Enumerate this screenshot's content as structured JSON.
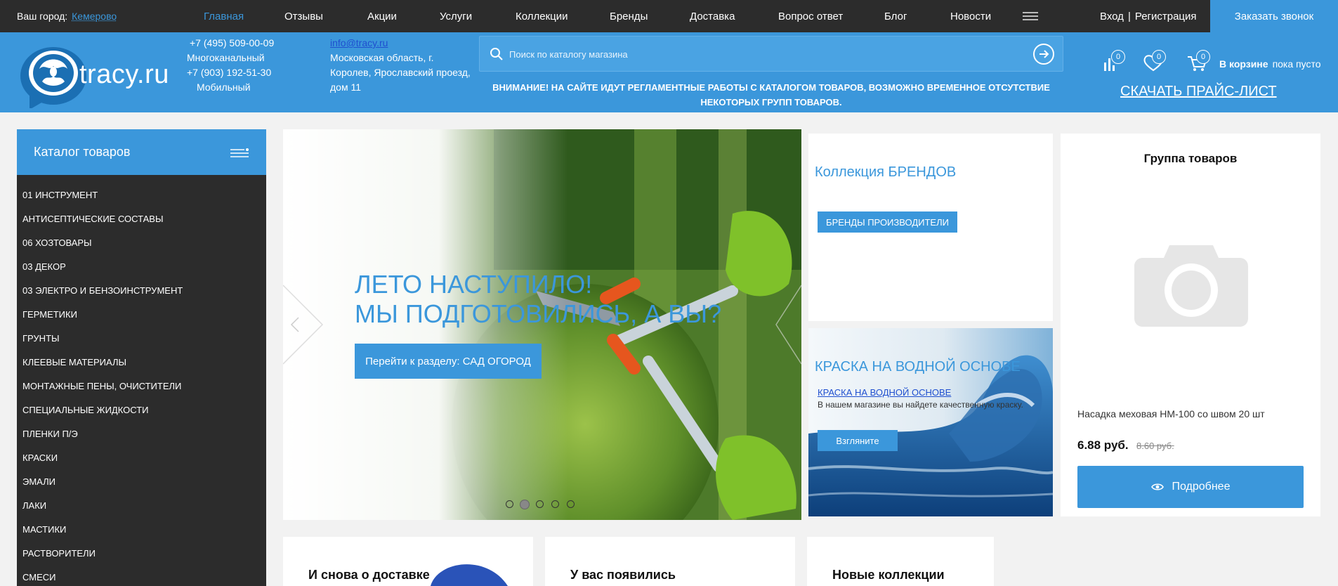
{
  "topbar": {
    "city_label": "Ваш город:",
    "city_name": "Кемерово",
    "nav": [
      "Главная",
      "Отзывы",
      "Акции",
      "Услуги",
      "Коллекции",
      "Бренды",
      "Доставка",
      "Вопрос ответ",
      "Блог",
      "Новости"
    ],
    "login": "Вход",
    "separator": "|",
    "register": "Регистрация",
    "callback": "Заказать звонок"
  },
  "header": {
    "logo_text": "tracy.ru",
    "phone1": "+7 (495) 509-00-09",
    "phone1_label": "Многоканальный",
    "phone2": "+7 (903) 192-51-30",
    "phone2_label": "Мобильный",
    "email": "info@tracy.ru",
    "address": "Московская область, г. Королев, Ярославский проезд, дом 11",
    "search_placeholder": "Поиск по каталогу магазина",
    "notice": "ВНИМАНИЕ! НА САЙТЕ ИДУТ РЕГЛАМЕНТНЫЕ РАБОТЫ С КАТАЛОГОМ ТОВАРОВ, ВОЗМОЖНО ВРЕМЕННОЕ ОТСУТСТВИЕ НЕКОТОРЫХ ГРУПП ТОВАРОВ.",
    "compare_count": "0",
    "favorites_count": "0",
    "cart_count": "0",
    "cart_label": "В корзине",
    "cart_status": "пока пусто",
    "pricelist": "СКАЧАТЬ ПРАЙС-ЛИСТ"
  },
  "catalog": {
    "title": "Каталог товаров",
    "items": [
      "01 ИНСТРУМЕНТ",
      "АНТИСЕПТИЧЕСКИЕ СОСТАВЫ",
      "06 ХОЗТОВАРЫ",
      "03 ДЕКОР",
      "03 ЭЛЕКТРО И БЕНЗОИНСТРУМЕНТ",
      "ГЕРМЕТИКИ",
      "ГРУНТЫ",
      "КЛЕЕВЫЕ МАТЕРИАЛЫ",
      "МОНТАЖНЫЕ ПЕНЫ, ОЧИСТИТЕЛИ",
      "СПЕЦИАЛЬНЫЕ ЖИДКОСТИ",
      "ПЛЕНКИ П/Э",
      "КРАСКИ",
      "ЭМАЛИ",
      "ЛАКИ",
      "МАСТИКИ",
      "РАСТВОРИТЕЛИ",
      "СМЕСИ"
    ]
  },
  "hero": {
    "title_line1": "ЛЕТО НАСТУПИЛО!",
    "title_line2": "МЫ ПОДГОТОВИЛИСЬ, А ВЫ?",
    "button": "Перейти к разделу:  САД ОГОРОД",
    "slide_count": 5,
    "active_slide": 2
  },
  "brands": {
    "title": "Коллекция БРЕНДОВ",
    "button": "БРЕНДЫ ПРОИЗВОДИТЕЛИ"
  },
  "paint": {
    "title": "КРАСКА НА ВОДНОЙ ОСНОВЕ",
    "link": "КРАСКА НА ВОДНОЙ ОСНОВЕ",
    "description": "В нашем магазине вы найдете качественную краску.",
    "button": "Взгляните"
  },
  "product": {
    "group_title": "Группа товаров",
    "name": "Насадка меховая НМ-100 со швом 20 шт",
    "price": "6.88 руб.",
    "old_price": "8.60 руб.",
    "button": "Подробнее"
  },
  "bottom_cards": [
    "И снова о доставке",
    "У вас появились",
    "Новые коллекции"
  ],
  "colors": {
    "accent": "#3b97db",
    "topbar": "#2c2c2c",
    "sidebar": "#2c2c2c",
    "background": "#f2f2f2"
  }
}
